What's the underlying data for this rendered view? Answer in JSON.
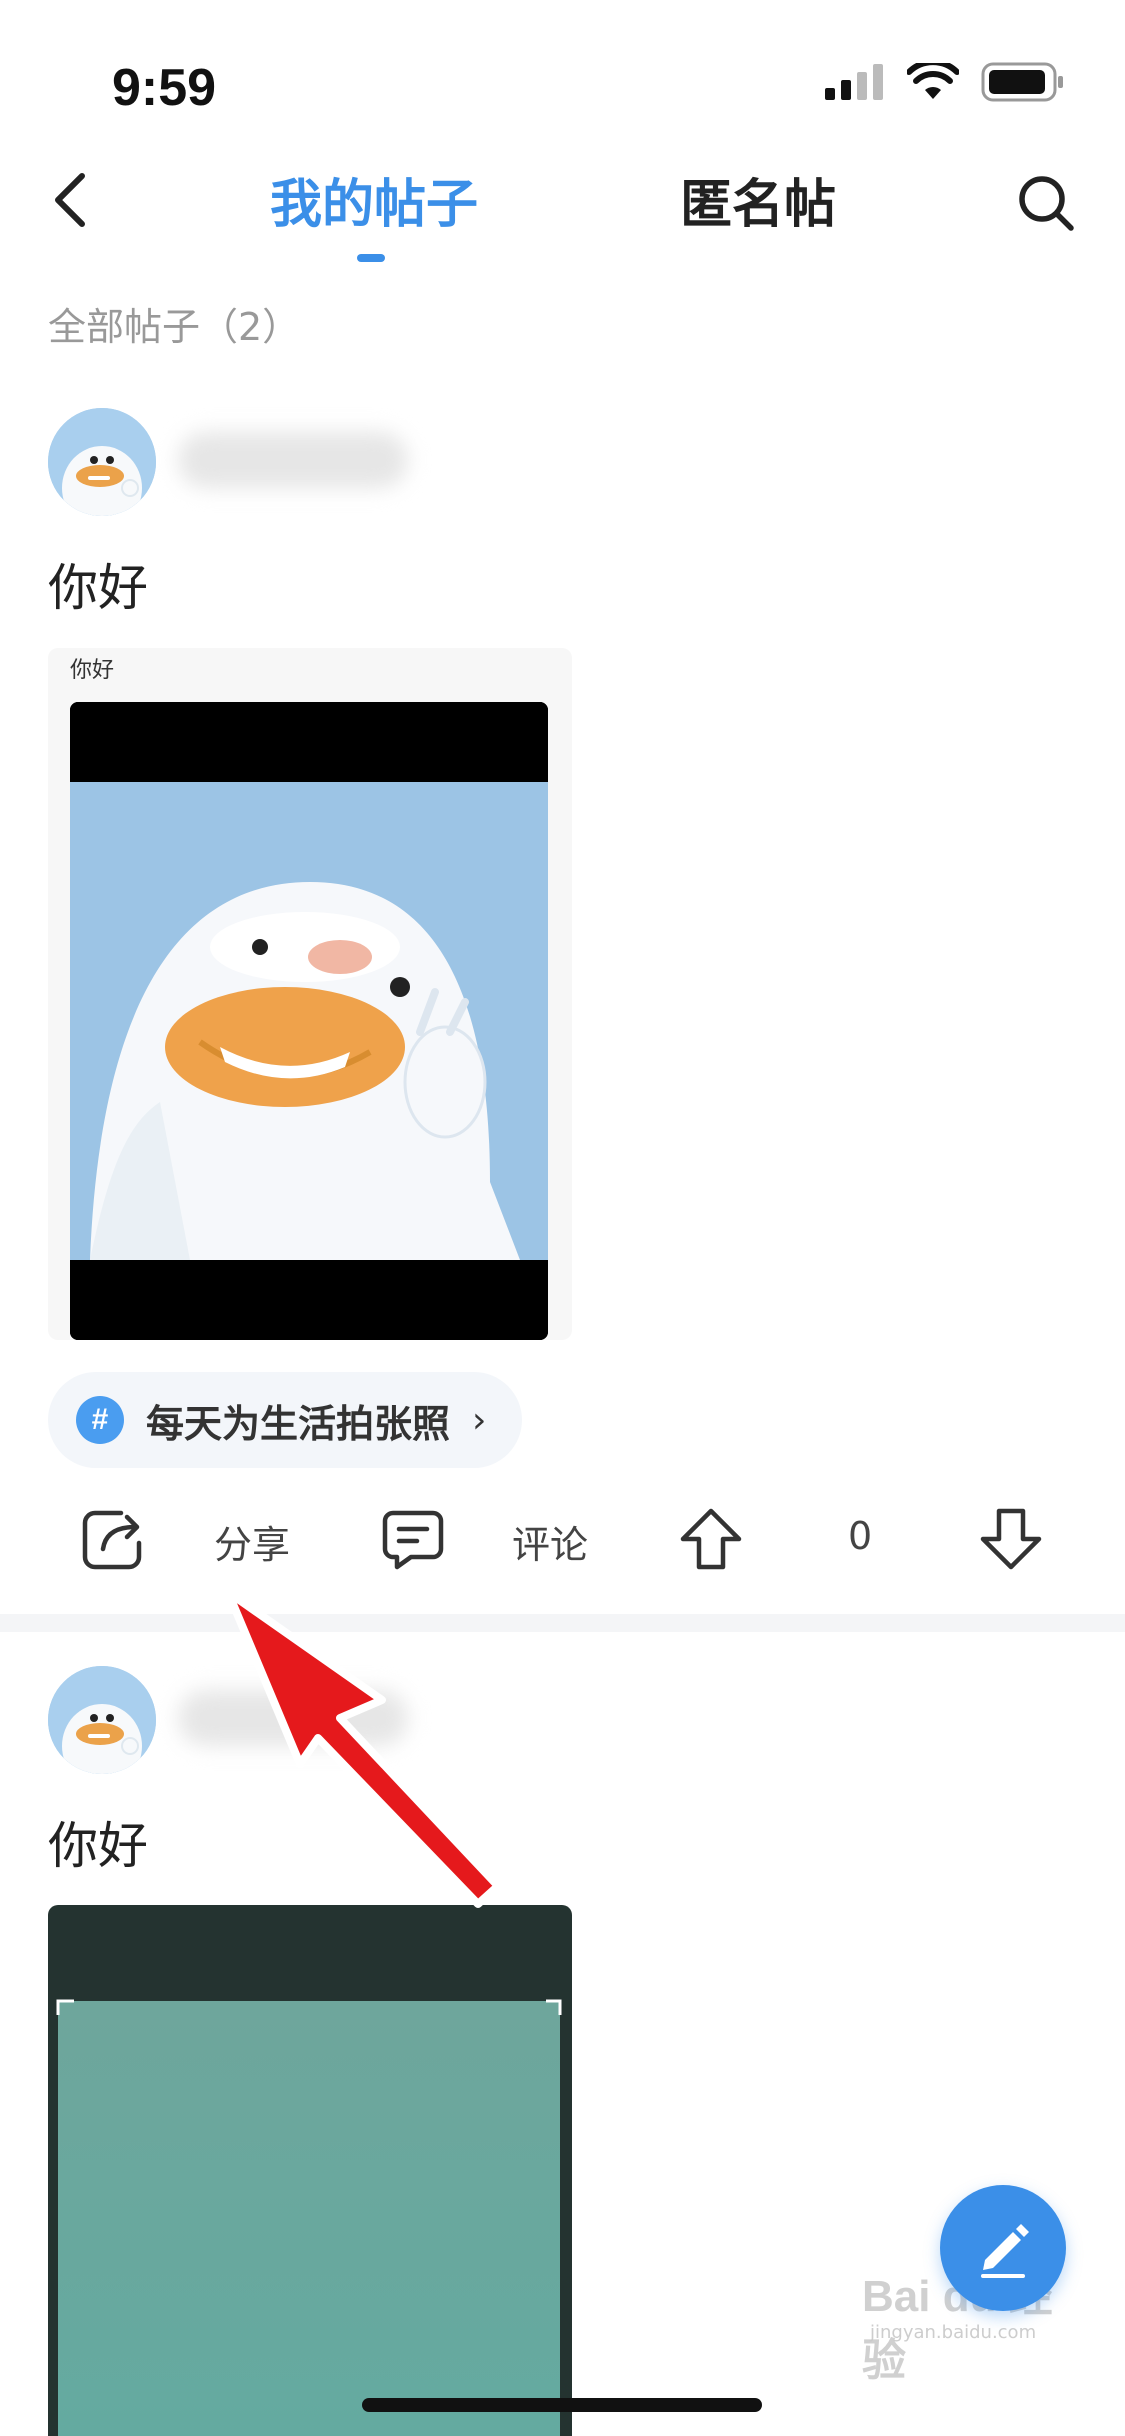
{
  "status_bar": {
    "time": "9:59"
  },
  "nav": {
    "tab_mine": "我的帖子",
    "tab_anonymous": "匿名帖",
    "active_tab": "tab_mine"
  },
  "filter": {
    "count_label": "全部帖子（2）"
  },
  "posts": [
    {
      "text": "你好",
      "image_caption": "你好",
      "topic": "每天为生活拍张照",
      "actions": {
        "share": "分享",
        "comment": "评论",
        "votes": "0"
      }
    },
    {
      "text": "你好"
    }
  ],
  "watermark": {
    "brand": "Bai du 经验",
    "site": "jingyan.baidu.com"
  },
  "colors": {
    "accent": "#3b8fe8",
    "annotation_arrow": "#e5191c"
  }
}
